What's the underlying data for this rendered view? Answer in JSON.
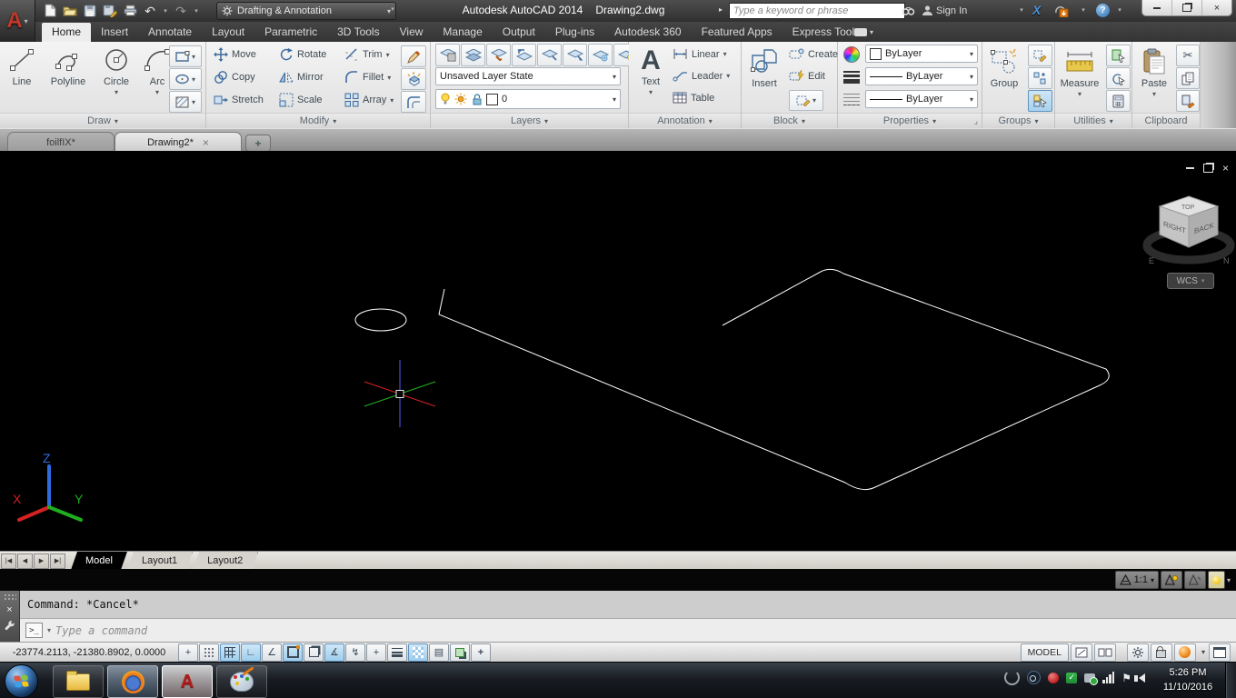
{
  "icons": {
    "caret_down": "▾",
    "caret_right": "▸",
    "undo": "↶",
    "redo": "↷",
    "close": "×",
    "plus": "+",
    "help": "?",
    "exchange_x": "X",
    "ortho": "∟",
    "polar": "∠",
    "otrack": "∡",
    "ducs": "↯",
    "quick_properties": "▤",
    "dynamic_input": "+",
    "annotation_monitor": "+",
    "scissors": "✂",
    "flag": "⚑",
    "check": "✓",
    "infer": "+"
  },
  "titlebar": {
    "app_title": "Autodesk AutoCAD 2014",
    "doc_title": "Drawing2.dwg",
    "workspace": "Drafting & Annotation",
    "search_placeholder": "Type a keyword or phrase",
    "sign_in": "Sign In"
  },
  "ribbon": {
    "tabs": [
      "Home",
      "Insert",
      "Annotate",
      "Layout",
      "Parametric",
      "3D Tools",
      "View",
      "Manage",
      "Output",
      "Plug-ins",
      "Autodesk 360",
      "Featured Apps",
      "Express Tools"
    ],
    "active_tab": "Home",
    "draw": {
      "title": "Draw",
      "line": "Line",
      "polyline": "Polyline",
      "circle": "Circle",
      "arc": "Arc"
    },
    "modify": {
      "title": "Modify",
      "move": "Move",
      "rotate": "Rotate",
      "trim": "Trim",
      "copy": "Copy",
      "mirror": "Mirror",
      "fillet": "Fillet",
      "stretch": "Stretch",
      "scale": "Scale",
      "array": "Array"
    },
    "layers": {
      "title": "Layers",
      "layer_state": "Unsaved Layer State",
      "current_layer": "0"
    },
    "annotation": {
      "title": "Annotation",
      "text": "Text",
      "linear": "Linear",
      "leader": "Leader",
      "table": "Table"
    },
    "block": {
      "title": "Block",
      "insert": "Insert",
      "create": "Create",
      "edit": "Edit"
    },
    "properties": {
      "title": "Properties",
      "color": "ByLayer",
      "lineweight": "ByLayer",
      "linetype": "ByLayer"
    },
    "groups": {
      "title": "Groups",
      "group": "Group"
    },
    "utilities": {
      "title": "Utilities",
      "measure": "Measure"
    },
    "clipboard": {
      "title": "Clipboard",
      "paste": "Paste"
    }
  },
  "file_tabs": {
    "tab1": "foilfIX*",
    "tab2": "Drawing2*"
  },
  "viewcube": {
    "top": "TOP",
    "left": "RIGHT",
    "right": "BACK",
    "compass_e": "E",
    "compass_n": "N",
    "wcs": "WCS"
  },
  "ucs": {
    "x": "X",
    "y": "Y",
    "z": "Z"
  },
  "layout_bar": {
    "nav": [
      "|◀",
      "◀",
      "▶",
      "▶|"
    ],
    "model": "Model",
    "layout1": "Layout1",
    "layout2": "Layout2"
  },
  "annotation_scale": {
    "label": "1:1"
  },
  "command": {
    "history": "Command: *Cancel*",
    "prompt_symbol": ">_",
    "placeholder": "Type a command"
  },
  "status": {
    "coords": "-23774.2113, -21380.8902, 0.0000",
    "model": "MODEL",
    "toggles": [
      {
        "name": "infer-constraints",
        "on": false
      },
      {
        "name": "snap-mode",
        "on": false
      },
      {
        "name": "grid-display",
        "on": true
      },
      {
        "name": "ortho-mode",
        "on": true
      },
      {
        "name": "polar-tracking",
        "on": false
      },
      {
        "name": "object-snap",
        "on": true
      },
      {
        "name": "3d-object-snap",
        "on": false
      },
      {
        "name": "object-snap-tracking",
        "on": true
      },
      {
        "name": "dynamic-ucs",
        "on": false
      },
      {
        "name": "dynamic-input",
        "on": false
      },
      {
        "name": "lineweight-display",
        "on": false
      },
      {
        "name": "transparency",
        "on": true
      },
      {
        "name": "quick-properties",
        "on": false
      },
      {
        "name": "selection-cycling",
        "on": false
      },
      {
        "name": "annotation-monitor",
        "on": false
      }
    ]
  },
  "taskbar": {
    "time": "5:26 PM",
    "date": "11/10/2016"
  }
}
